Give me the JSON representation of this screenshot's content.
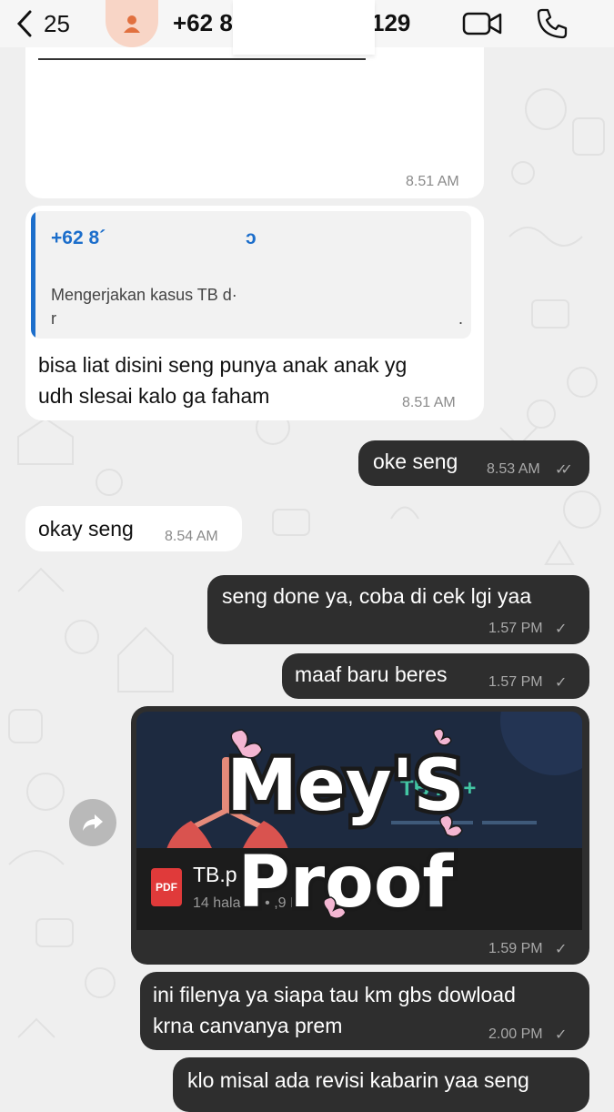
{
  "header": {
    "back_count": "25",
    "contact_name_start": "+62 8",
    "contact_name_end": "129"
  },
  "messages": [
    {
      "id": "m1",
      "direction": "in",
      "text": "",
      "time": "8.51 AM"
    },
    {
      "id": "m2",
      "direction": "in",
      "quote_name": "+62 8´",
      "quote_name_end": "ɔ",
      "quote_text": "Mengerjakan kasus TB d·",
      "quote_line2": "r",
      "quote_dot": ".",
      "text_line1": "bisa liat disini seng punya anak anak yg",
      "text_line2": "udh slesai kalo ga faham",
      "time": "8.51 AM"
    },
    {
      "id": "m3",
      "direction": "out",
      "text": "oke seng",
      "time": "8.53 AM",
      "status": "✓✓"
    },
    {
      "id": "m4",
      "direction": "in",
      "text": "okay seng",
      "time": "8.54 AM"
    },
    {
      "id": "m5",
      "direction": "out",
      "text": "seng done ya, coba di cek lgi yaa",
      "time": "1.57 PM",
      "status": "✓"
    },
    {
      "id": "m6",
      "direction": "out",
      "text": "maaf baru beres",
      "time": "1.57 PM",
      "status": "✓"
    },
    {
      "id": "m7",
      "direction": "out",
      "doc_name": "TB.p",
      "doc_meta": "14 hala  an • ,9 M",
      "pdf_label": "PDF",
      "preview_text": "TB  ru +",
      "time": "1.59 PM",
      "status": "✓"
    },
    {
      "id": "m8",
      "direction": "out",
      "text_line1": "ini filenya ya siapa tau km gbs dowload",
      "text_line2": "krna canvanya prem",
      "time": "2.00 PM",
      "status": "✓"
    },
    {
      "id": "m9",
      "direction": "out",
      "text": "klo misal ada revisi kabarin yaa seng"
    }
  ],
  "watermark": {
    "line1": "Mey'S",
    "line2": "Proof"
  },
  "colors": {
    "out_bubble": "#2e2e2e",
    "in_bubble": "#ffffff",
    "link_blue": "#1c6ecb",
    "avatar_bg": "#f8d5c6",
    "pdf_red": "#e03a3a"
  },
  "icons": [
    "chevron-left-icon",
    "person-icon",
    "video-camera-icon",
    "phone-icon",
    "forward-icon",
    "pdf-icon",
    "double-check-icon",
    "check-icon"
  ]
}
